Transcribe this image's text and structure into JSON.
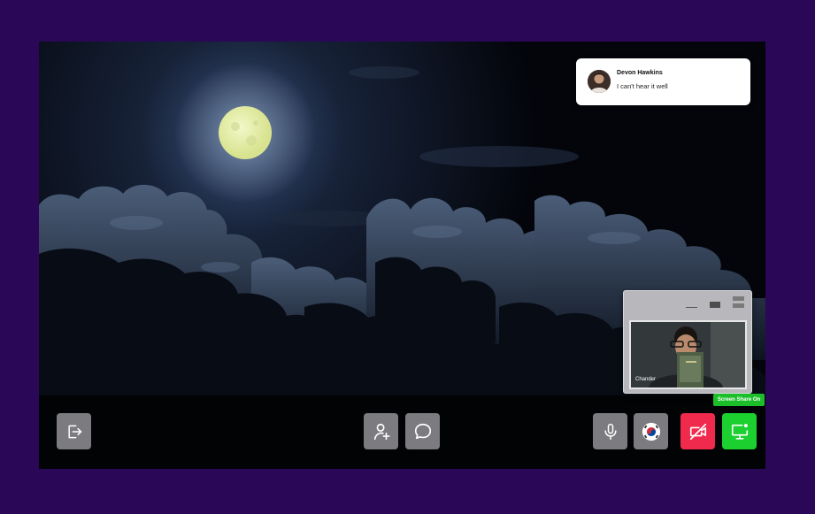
{
  "notification": {
    "sender": "Devon Hawkins",
    "message": "I can't hear it well"
  },
  "pip": {
    "participant": "Chander"
  },
  "screen_share": {
    "badge": "Screen Share On"
  },
  "icons": {
    "leave": "leave-icon",
    "add_user": "add-user-icon",
    "chat": "chat-icon",
    "mic": "mic-icon",
    "language": "korea-flag-icon",
    "camera_off": "camera-off-icon",
    "screen_share": "screen-share-icon"
  },
  "colors": {
    "page_background": "#2a0757",
    "button_gray": "#7c7c80",
    "camera_off_red": "#f02a4d",
    "screen_share_green": "#1bd02f"
  }
}
